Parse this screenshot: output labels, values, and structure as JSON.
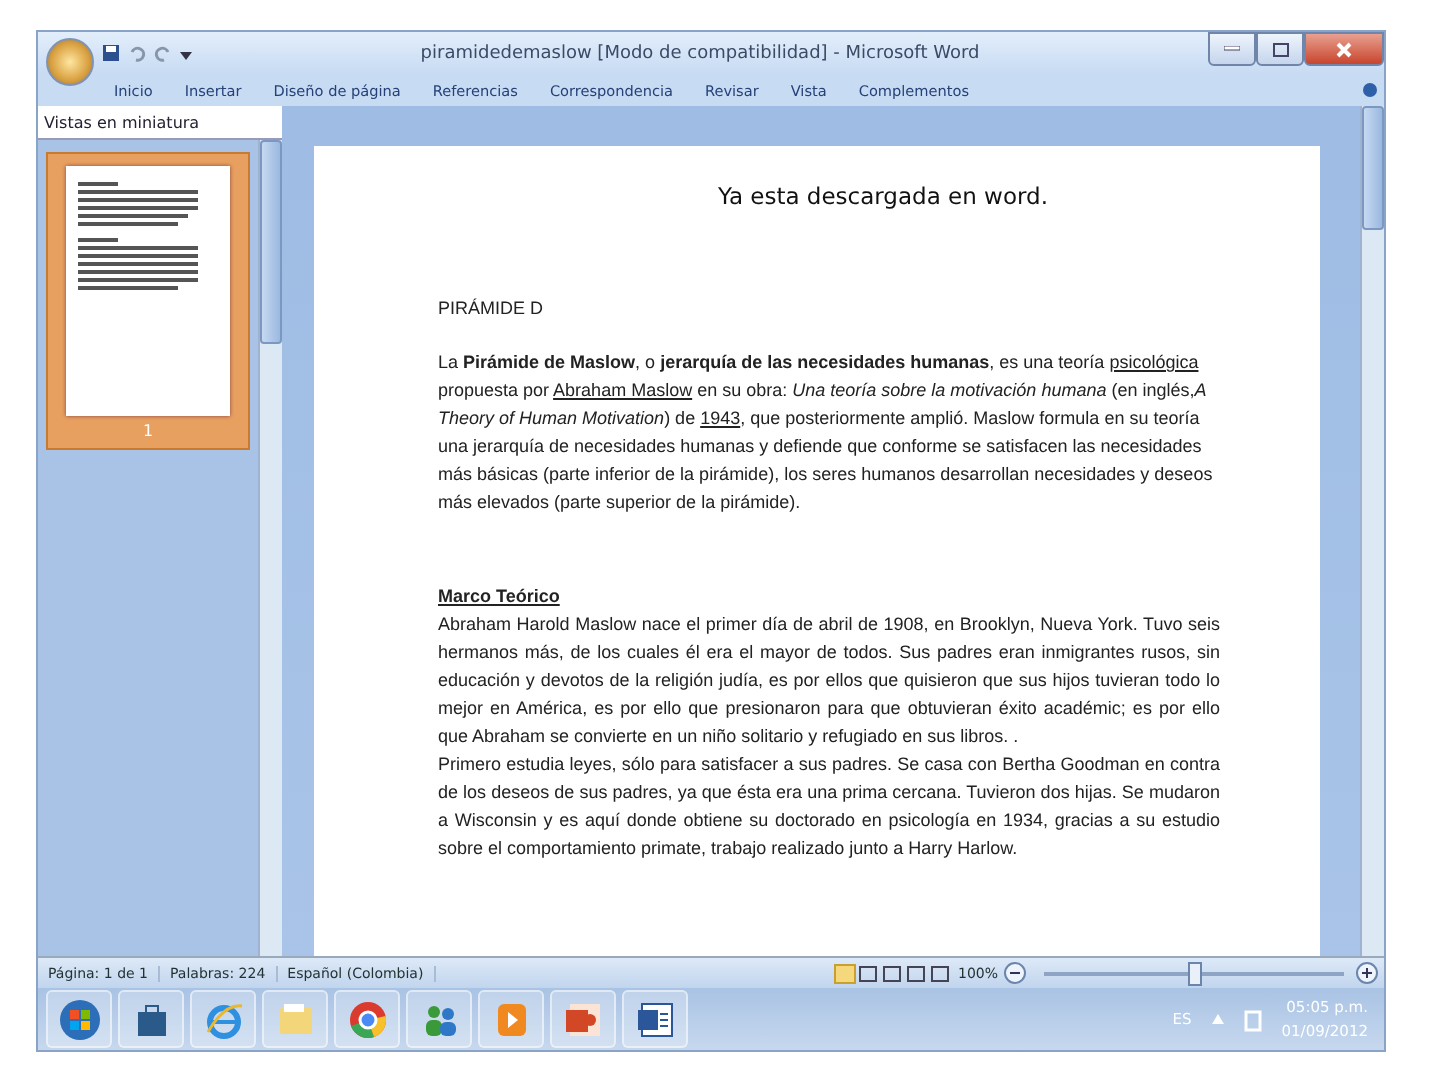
{
  "window": {
    "title": "piramidedemaslow [Modo de compatibilidad] - Microsoft Word"
  },
  "ribbon_tabs": [
    {
      "label": "Inicio",
      "selected": false
    },
    {
      "label": "Insertar",
      "selected": false
    },
    {
      "label": "Diseño de página",
      "selected": false
    },
    {
      "label": "Referencias",
      "selected": false
    },
    {
      "label": "Correspondencia",
      "selected": false
    },
    {
      "label": "Revisar",
      "selected": false
    },
    {
      "label": "Vista",
      "selected": false
    },
    {
      "label": "Complementos",
      "selected": false
    }
  ],
  "thumbnail_pane": {
    "title": "Vistas en miniatura",
    "pages": [
      {
        "number": "1",
        "selected": true
      }
    ]
  },
  "caption": "Ya esta descargada en word.",
  "document": {
    "heading": "PIRÁMIDE D",
    "paragraph_1": [
      {
        "kind": "plain",
        "text": "La "
      },
      {
        "kind": "bold",
        "text": "Pirámide de Maslow"
      },
      {
        "kind": "plain",
        "text": ", o "
      },
      {
        "kind": "bold",
        "text": "jerarquía de las necesidades humanas"
      },
      {
        "kind": "plain",
        "text": ", es una teoría "
      },
      {
        "kind": "link",
        "text": "psicológica"
      },
      {
        "kind": "plain",
        "text": " propuesta por "
      },
      {
        "kind": "link",
        "text": "Abraham Maslow"
      },
      {
        "kind": "plain",
        "text": " en su obra: "
      },
      {
        "kind": "italic",
        "text": "Una teoría sobre la motivación humana"
      },
      {
        "kind": "plain",
        "text": " (en inglés,"
      },
      {
        "kind": "italic",
        "text": "A Theory of Human Motivation"
      },
      {
        "kind": "plain",
        "text": ") de "
      },
      {
        "kind": "link",
        "text": "1943"
      },
      {
        "kind": "plain",
        "text": ", que posteriormente amplió. Maslow formula en su teoría una jerarquía de necesidades humanas y defiende que conforme se satisfacen las necesidades más básicas (parte inferior de la pirámide), los seres humanos desarrollan necesidades y deseos más elevados (parte superior de la pirámide)."
      }
    ],
    "section_heading": "Marco Teórico",
    "paragraph_2": "Abraham Harold Maslow nace el primer día de abril de 1908, en Brooklyn, Nueva York. Tuvo seis hermanos más, de los cuales él era el mayor de todos. Sus padres eran inmigrantes rusos, sin educación y devotos de la religión judía, es por ellos que quisieron que sus hijos tuvieran todo lo mejor en América, es por ello que presionaron para que obtuvieran éxito académic; es por ello que Abraham se convierte en un niño solitario y refugiado en sus libros. .",
    "paragraph_3": "Primero estudia leyes, sólo para satisfacer a sus padres. Se casa con Bertha Goodman en contra de los deseos de sus padres, ya que ésta era una prima cercana. Tuvieron dos hijas. Se mudaron a Wisconsin y es aquí donde obtiene su doctorado en psicología en 1934, gracias a su estudio sobre el comportamiento primate, trabajo realizado junto a Harry Harlow."
  },
  "status_bar": {
    "items": [
      "Página: 1 de 1",
      "Palabras: 224",
      "Español (Colombia)"
    ],
    "zoom": "100%",
    "zoom_slider": {
      "level": 0.5
    }
  },
  "taskbar": {
    "apps": [
      {
        "kind": "start"
      },
      {
        "kind": "store"
      },
      {
        "kind": "ie"
      },
      {
        "kind": "folder"
      },
      {
        "kind": "chrome"
      },
      {
        "kind": "people"
      },
      {
        "kind": "media"
      },
      {
        "kind": "powerpoint"
      },
      {
        "kind": "word"
      }
    ],
    "language": "ES",
    "time": "05:05 p.m.",
    "date": "01/09/2012"
  }
}
